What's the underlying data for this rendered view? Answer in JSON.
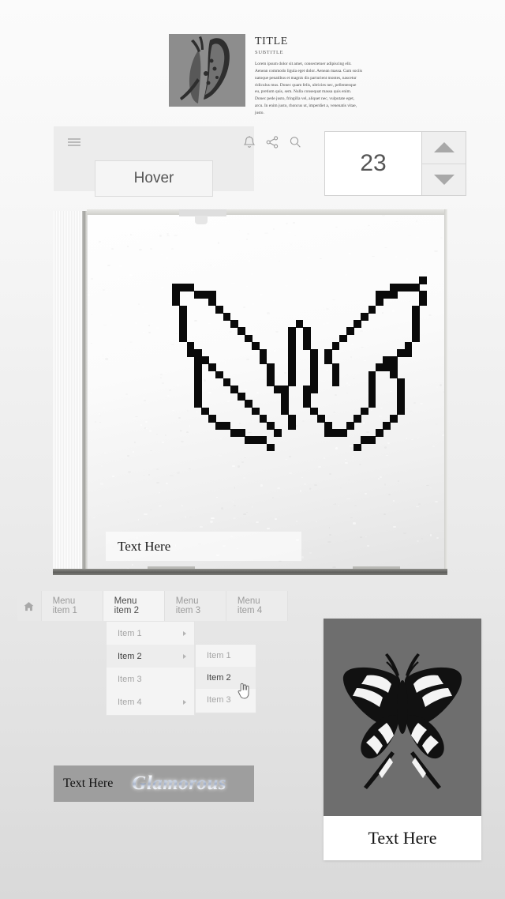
{
  "article": {
    "title": "TITLE",
    "subtitle": "SUBTITLE",
    "body": "Lorem ipsum dolor sit amet, consectetuer adipiscing elit. Aenean commodo ligula eget dolor. Aenean massa. Cum sociis natoque penatibus et magnis dis parturient montes, nascetur ridiculus mus. Donec quam felis, ultricies nec, pellentesque eu, pretium quis, sem. Nulla consequat massa quis enim. Donec pede justo, fringilla vel, aliquet nec, vulputate eget, arcu. In enim justo, rhoncus ut, imperdiet a, venenatis vitae, justo.",
    "thumb_alt": "butterfly-side-view"
  },
  "toolbar": {
    "menu_icon": "hamburger-icon",
    "bell_icon": "bell-icon",
    "share_icon": "share-icon",
    "search_icon": "search-icon",
    "tooltip_label": "Hover"
  },
  "stepper": {
    "value": "23",
    "increment_icon": "triangle-up-icon",
    "decrement_icon": "triangle-down-icon"
  },
  "cd_case": {
    "overlay_text": "Text Here",
    "artwork_alt": "pixel-art-butterfly"
  },
  "menubar": {
    "home_icon": "home-icon",
    "items": [
      {
        "label": "Menu item 1",
        "active": false
      },
      {
        "label": "Menu item 2",
        "active": true
      },
      {
        "label": "Menu item 3",
        "active": false
      },
      {
        "label": "Menu item 4",
        "active": false
      }
    ],
    "dropdown": [
      {
        "label": "Item 1",
        "has_submenu": true,
        "active": false
      },
      {
        "label": "Item 2",
        "has_submenu": true,
        "active": true
      },
      {
        "label": "Item 3",
        "has_submenu": false,
        "active": false
      },
      {
        "label": "Item 4",
        "has_submenu": true,
        "active": false
      }
    ],
    "submenu": [
      {
        "label": "Item 1",
        "active": false
      },
      {
        "label": "Item 2",
        "active": true
      },
      {
        "label": "Item 3",
        "active": false
      }
    ],
    "cursor_icon": "pointing-hand-cursor"
  },
  "banner": {
    "text": "Text Here",
    "word": "Glamorous",
    "background_color": "#9e9e9e"
  },
  "card": {
    "caption": "Text Here",
    "image_alt": "swallowtail-butterfly",
    "image_background": "#6e6e6e"
  },
  "theme": {
    "page_gradient_top": "#fbfbfb",
    "page_gradient_bottom": "#d9d9d9",
    "muted_text": "#9b9b9b",
    "active_text": "#3f3f3f"
  }
}
